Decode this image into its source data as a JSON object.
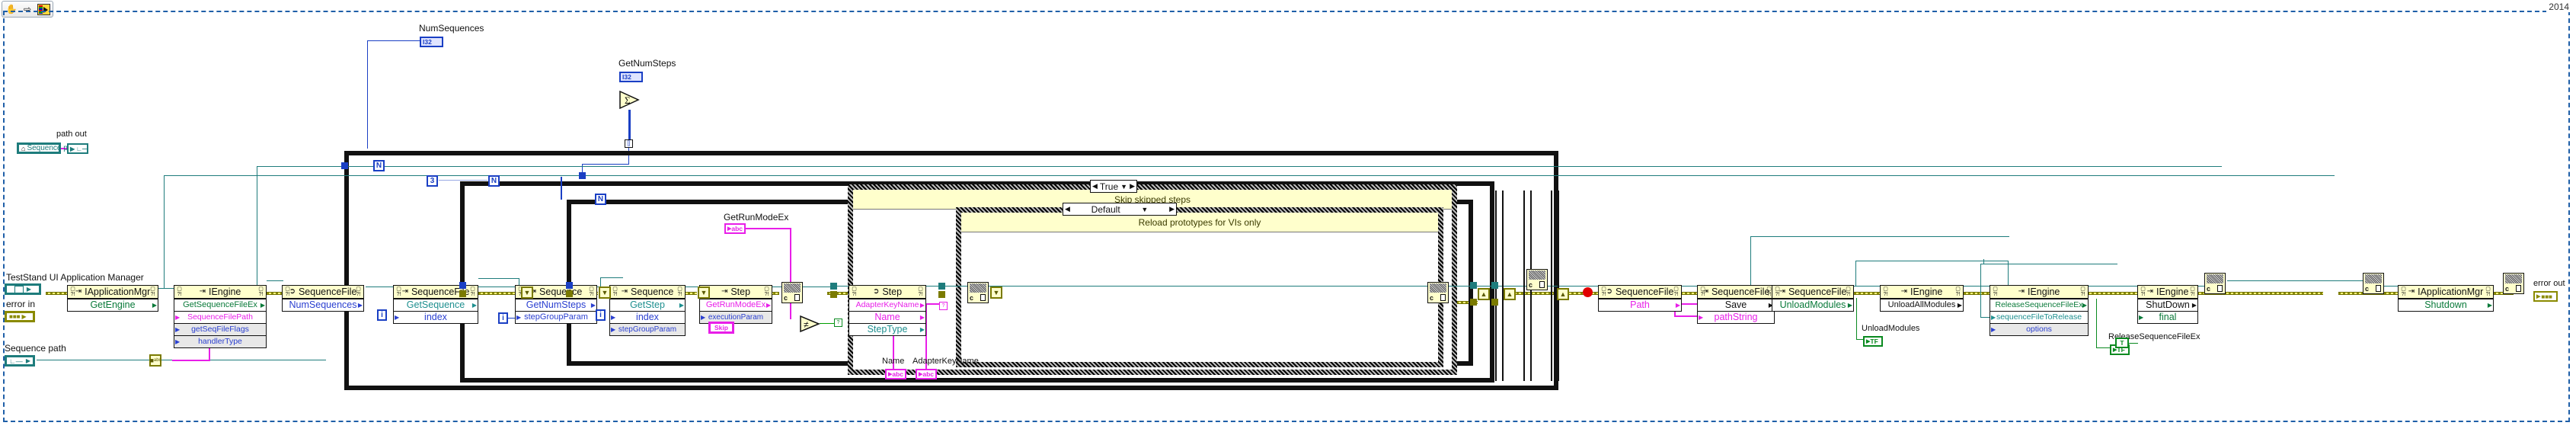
{
  "window": {
    "version_tag": "2014",
    "toolbar": {
      "buttons": [
        {
          "name": "hand-tool",
          "label": "✋"
        },
        {
          "name": "run-arrow",
          "label": "⇨"
        },
        {
          "name": "vi-icon",
          "label": ""
        }
      ]
    }
  },
  "labels": {
    "app_manager": "TestStand UI Application Manager",
    "error_in": "error in",
    "sequence_path": "Sequence path",
    "path_out": "path out",
    "num_sequences": "NumSequences",
    "get_num_steps": "GetNumSteps",
    "get_run_mode_ex": "GetRunModeEx",
    "name": "Name",
    "adapter_key_name": "AdapterKeyName",
    "unload_modules": "UnloadModules",
    "release_sequence_file_ex": "ReleaseSequenceFileEx",
    "error_out": "error out"
  },
  "terminals": {
    "sequence_path_ctrl": "Sequence path",
    "path_out": "path out",
    "num_sequences": "I32",
    "get_num_steps": "I32",
    "get_run_mode_ex": "abc",
    "name": "abc",
    "adapter_key_name": "abc",
    "unload_modules": "TF",
    "release_sequence_file_ex": "TF",
    "final_true": "T",
    "index_i": "i",
    "count_n": "N",
    "count_3": "3"
  },
  "cases": {
    "outer": {
      "selector": "True",
      "subtitle": "Skip skipped steps"
    },
    "inner": {
      "selector": "Default",
      "subtitle": "Reload prototypes for VIs only"
    }
  },
  "nodes": [
    {
      "id": "app-mgr-getengine",
      "kind": "invoke",
      "class": "IApplicationMgr",
      "method": "GetEngine",
      "method_color": "green",
      "params": []
    },
    {
      "id": "engine-getsequencefileex",
      "kind": "invoke",
      "class": "IEngine",
      "method": "GetSequenceFileEx",
      "method_color": "green",
      "params": [
        {
          "label": "SequenceFilePath",
          "color": "mag"
        },
        {
          "label": "getSeqFileFlags",
          "color": "blue"
        },
        {
          "label": "handlerType",
          "color": "blue"
        }
      ]
    },
    {
      "id": "seqfile-numsequences",
      "kind": "property",
      "class": "SequenceFile",
      "method": "NumSequences",
      "method_color": "blue",
      "params": []
    },
    {
      "id": "seqfile-getsequence",
      "kind": "invoke",
      "class": "SequenceFile",
      "method": "GetSequence",
      "method_color": "teal",
      "params": [
        {
          "label": "index",
          "color": "blue"
        }
      ]
    },
    {
      "id": "sequence-getnumsteps",
      "kind": "invoke",
      "class": "Sequence",
      "method": "GetNumSteps",
      "method_color": "blue",
      "params": [
        {
          "label": "stepGroupParam",
          "color": "blue"
        }
      ]
    },
    {
      "id": "sequence-getstep",
      "kind": "invoke",
      "class": "Sequence",
      "method": "GetStep",
      "method_color": "teal",
      "params": [
        {
          "label": "index",
          "color": "blue"
        },
        {
          "label": "stepGroupParam",
          "color": "blue"
        }
      ]
    },
    {
      "id": "step-getrunmodeex",
      "kind": "invoke",
      "class": "Step",
      "method": "GetRunModeEx",
      "method_color": "mag",
      "params": [
        {
          "label": "executionParam",
          "color": "blue"
        }
      ]
    },
    {
      "id": "step-properties",
      "kind": "property",
      "class": "Step",
      "method": "AdapterKeyName",
      "method_color": "mag",
      "params": [
        {
          "label": "Name",
          "color": "mag"
        },
        {
          "label": "StepType",
          "color": "teal"
        }
      ]
    },
    {
      "id": "seqfile-path",
      "kind": "property",
      "class": "SequenceFile",
      "method": "Path",
      "method_color": "mag",
      "params": []
    },
    {
      "id": "seqfile-save",
      "kind": "invoke",
      "class": "SequenceFile",
      "method": "Save",
      "method_color": "black",
      "params": [
        {
          "label": "pathString",
          "color": "mag"
        }
      ]
    },
    {
      "id": "seqfile-unloadmodules",
      "kind": "invoke",
      "class": "SequenceFile",
      "method": "UnloadModules",
      "method_color": "green",
      "params": []
    },
    {
      "id": "engine-unloadallmodules",
      "kind": "invoke",
      "class": "IEngine",
      "method": "UnloadAllModules",
      "method_color": "black",
      "params": []
    },
    {
      "id": "engine-releasesequencefileex",
      "kind": "invoke",
      "class": "IEngine",
      "method": "ReleaseSequenceFileEx",
      "method_color": "green",
      "params": [
        {
          "label": "sequenceFileToRelease",
          "color": "teal"
        },
        {
          "label": "options",
          "color": "blue",
          "grey": true
        }
      ]
    },
    {
      "id": "engine-shutdown",
      "kind": "invoke",
      "class": "IEngine",
      "method": "ShutDown",
      "method_color": "black",
      "params": [
        {
          "label": "final",
          "color": "green"
        }
      ]
    },
    {
      "id": "app-mgr-shutdown",
      "kind": "invoke",
      "class": "IApplicationMgr",
      "method": "Shutdown",
      "method_color": "green",
      "params": []
    }
  ],
  "strings": {
    "skip": "Skip",
    "step_label": "Step",
    "true_sel": "True",
    "default_sel": "Default"
  },
  "colors": {
    "header_yellow": "#ffffcc",
    "wire_teal": "#1e7c7c",
    "wire_blue": "#1a3fc4",
    "wire_magenta": "#e81ee8",
    "wire_error": "#8a8a00",
    "wire_green": "#0a8a20",
    "boundary_blue": "#1f5fa8"
  }
}
